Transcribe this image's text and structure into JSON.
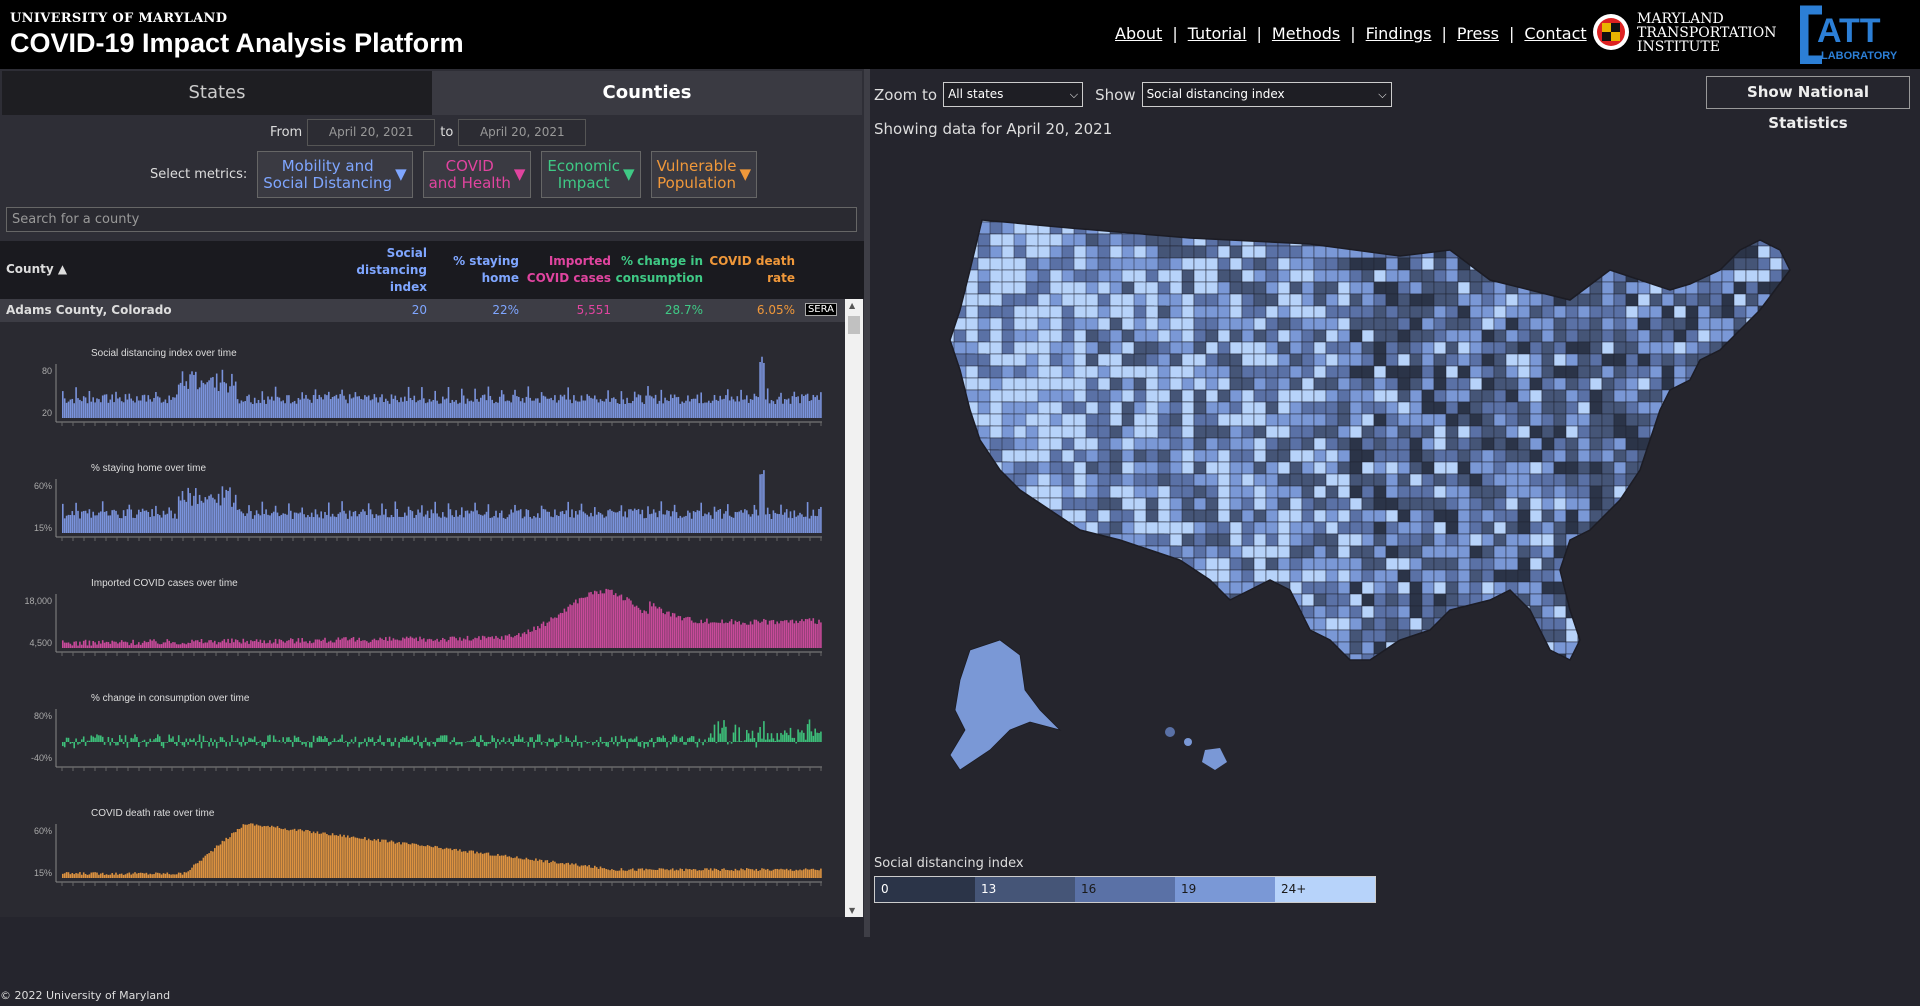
{
  "header": {
    "university": "UNIVERSITY OF MARYLAND",
    "title": "COVID-19 Impact Analysis Platform",
    "nav": [
      "About",
      "Tutorial",
      "Methods",
      "Findings",
      "Press",
      "Contact"
    ],
    "institute_lines": [
      "MARYLAND",
      "TRANSPORTATION",
      "INSTITUTE"
    ],
    "lab_logo": "CATT LABORATORY"
  },
  "tabs": {
    "states": "States",
    "counties": "Counties"
  },
  "dates": {
    "from_label": "From",
    "from": "April 20, 2021",
    "to_label": "to",
    "to": "April 20, 2021"
  },
  "metrics": {
    "label": "Select metrics:",
    "buttons": [
      {
        "lines": [
          "Mobility and",
          "Social Distancing"
        ],
        "color": "#7fa6ff"
      },
      {
        "lines": [
          "COVID",
          "and Health"
        ],
        "color": "#e0449f"
      },
      {
        "lines": [
          "Economic",
          "Impact"
        ],
        "color": "#3fc985"
      },
      {
        "lines": [
          "Vulnerable",
          "Population"
        ],
        "color": "#f0983a"
      }
    ]
  },
  "search": {
    "placeholder": "Search for a county"
  },
  "table": {
    "county_header": "County ▲",
    "columns": [
      {
        "lines": [
          "Social",
          "distancing",
          "index"
        ],
        "color": "#7fa6ff"
      },
      {
        "lines": [
          "% staying",
          "home"
        ],
        "color": "#7fa6ff"
      },
      {
        "lines": [
          "Imported",
          "COVID cases"
        ],
        "color": "#e0449f"
      },
      {
        "lines": [
          "% change in",
          "consumption"
        ],
        "color": "#3fc985"
      },
      {
        "lines": [
          "COVID death",
          "rate"
        ],
        "color": "#f0983a"
      }
    ],
    "row": {
      "county": "Adams County, Colorado",
      "values": [
        "20",
        "22%",
        "5,551",
        "28.7%",
        "6.05%"
      ],
      "badge": "SERA"
    }
  },
  "charts": [
    {
      "title": "Social distancing index over time",
      "ticks": [
        "80",
        "20"
      ],
      "color": "#7a93dc",
      "shape": "sdi"
    },
    {
      "title": "% staying home over time",
      "ticks": [
        "60%",
        "15%"
      ],
      "color": "#7a93dc",
      "shape": "sdi"
    },
    {
      "title": "Imported COVID cases over time",
      "ticks": [
        "18,000",
        "4,500"
      ],
      "color": "#c84a9a",
      "shape": "cases"
    },
    {
      "title": "% change in consumption over time",
      "ticks": [
        "80%",
        "-40%"
      ],
      "color": "#3dbf7a",
      "shape": "consumption"
    },
    {
      "title": "COVID death rate over time",
      "ticks": [
        "60%",
        "15%"
      ],
      "color": "#dc9240",
      "shape": "death"
    }
  ],
  "footer": "© 2022 University of Maryland",
  "map_controls": {
    "zoom_label": "Zoom to",
    "zoom_value": "All states",
    "show_label": "Show",
    "show_value": "Social distancing index",
    "national_button": "Show National Statistics",
    "showing": "Showing data for April 20, 2021"
  },
  "legend": {
    "title": "Social distancing index",
    "bins": [
      {
        "label": "0",
        "color": "#2b3448"
      },
      {
        "label": "13",
        "color": "#455577"
      },
      {
        "label": "16",
        "color": "#5a71a6"
      },
      {
        "label": "19",
        "color": "#7a98d6"
      },
      {
        "label": "24+",
        "color": "#b7d3fa"
      }
    ]
  }
}
